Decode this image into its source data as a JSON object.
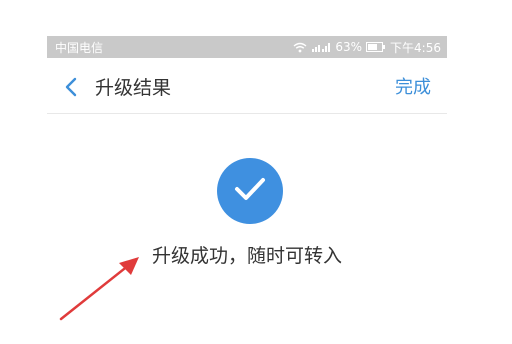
{
  "status_bar": {
    "carrier": "中国电信",
    "battery": "63%",
    "time": "下午4:56",
    "icons": [
      "wifi-icon",
      "signal-icon",
      "battery-icon"
    ]
  },
  "nav": {
    "back_icon": "chevron-left-icon",
    "title": "升级结果",
    "done_label": "完成"
  },
  "main": {
    "success_icon": "check-icon",
    "message": "升级成功，随时可转入"
  },
  "colors": {
    "accent": "#3f90e0",
    "link": "#3d8fd9",
    "status_bar_bg": "#c9c9c9",
    "arrow": "#e03b3b"
  }
}
